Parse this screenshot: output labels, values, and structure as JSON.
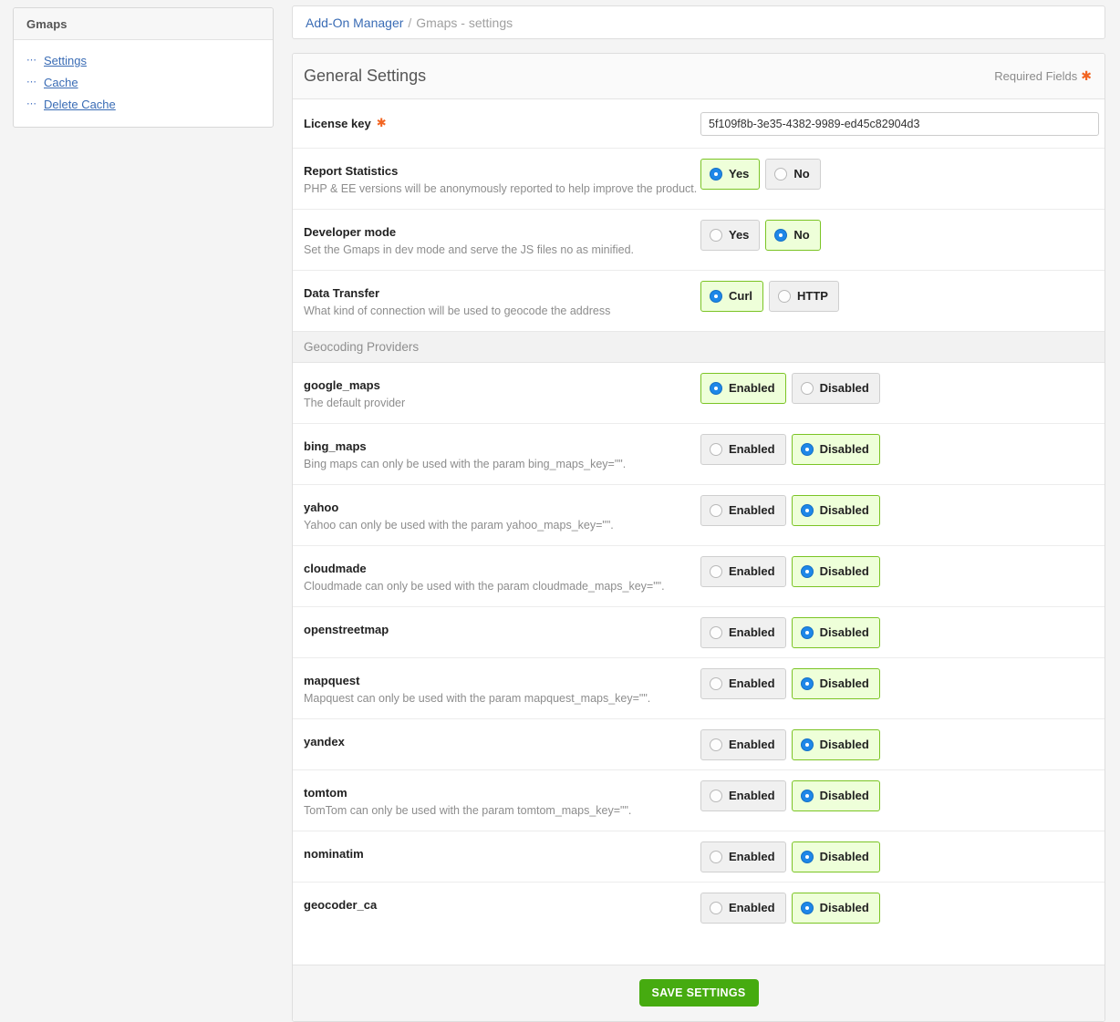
{
  "sidebar": {
    "title": "Gmaps",
    "bullet_icon": "dots-icon",
    "items": [
      {
        "label": "Settings"
      },
      {
        "label": "Cache"
      },
      {
        "label": "Delete Cache"
      }
    ]
  },
  "breadcrumb": {
    "link": "Add-On Manager",
    "separator": "/",
    "current": "Gmaps - settings"
  },
  "panel": {
    "title": "General Settings",
    "required_note": "Required Fields",
    "required_marker": "✱",
    "accent_green": "#7bc425",
    "accent_blue": "#1e87e8",
    "accent_orange": "#f26522",
    "save_button_color": "#46ab10"
  },
  "license": {
    "label": "License key",
    "required_marker": "✱",
    "value": "5f109f8b-3e35-4382-9989-ed45c82904d3",
    "placeholder": ""
  },
  "settings_rows": [
    {
      "name": "Report Statistics",
      "desc": "PHP & EE versions will be anonymously reported to help improve the product.",
      "options": [
        {
          "label": "Yes",
          "selected": true
        },
        {
          "label": "No",
          "selected": false
        }
      ]
    },
    {
      "name": "Developer mode",
      "desc": "Set the Gmaps in dev mode and serve the JS files no as minified.",
      "options": [
        {
          "label": "Yes",
          "selected": false
        },
        {
          "label": "No",
          "selected": true
        }
      ]
    },
    {
      "name": "Data Transfer",
      "desc": "What kind of connection will be used to geocode the address",
      "options": [
        {
          "label": "Curl",
          "selected": true
        },
        {
          "label": "HTTP",
          "selected": false
        }
      ]
    }
  ],
  "providers_section": {
    "heading": "Geocoding Providers",
    "enabled_label": "Enabled",
    "disabled_label": "Disabled",
    "providers": [
      {
        "name": "google_maps",
        "desc": "The default provider",
        "enabled": true
      },
      {
        "name": "bing_maps",
        "desc": "Bing maps can only be used with the param bing_maps_key=\"\".",
        "enabled": false
      },
      {
        "name": "yahoo",
        "desc": "Yahoo can only be used with the param yahoo_maps_key=\"\".",
        "enabled": false
      },
      {
        "name": "cloudmade",
        "desc": "Cloudmade can only be used with the param cloudmade_maps_key=\"\".",
        "enabled": false
      },
      {
        "name": "openstreetmap",
        "desc": "",
        "enabled": false
      },
      {
        "name": "mapquest",
        "desc": "Mapquest can only be used with the param mapquest_maps_key=\"\".",
        "enabled": false
      },
      {
        "name": "yandex",
        "desc": "",
        "enabled": false
      },
      {
        "name": "tomtom",
        "desc": "TomTom can only be used with the param tomtom_maps_key=\"\".",
        "enabled": false
      },
      {
        "name": "nominatim",
        "desc": "",
        "enabled": false
      },
      {
        "name": "geocoder_ca",
        "desc": "",
        "enabled": false
      }
    ]
  },
  "footer": {
    "save_label": "SAVE SETTINGS"
  }
}
